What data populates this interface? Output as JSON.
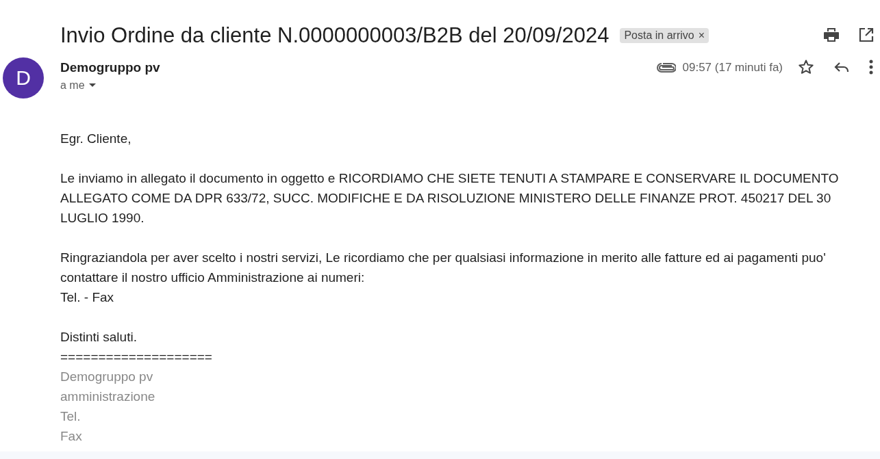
{
  "subject": "Invio Ordine da cliente N.0000000003/B2B del 20/09/2024",
  "label": {
    "text": "Posta in arrivo",
    "remove": "×"
  },
  "sender": {
    "initial": "D",
    "name": "Demogruppo pv",
    "recipient": "a me"
  },
  "time": "09:57 (17 minuti fa)",
  "starred": false,
  "has_attachment": true,
  "body": [
    {
      "kind": "text",
      "text": "Egr. Cliente,"
    },
    {
      "kind": "text",
      "text": "Le inviamo in allegato il documento in oggetto e RICORDIAMO CHE SIETE TENUTI A STAMPARE E CONSERVARE IL DOCUMENTO ALLEGATO COME DA DPR 633/72, SUCC. MODIFICHE E DA RISOLUZIONE MINISTERO DELLE FINANZE PROT. 450217 DEL 30 LUGLIO 1990."
    },
    {
      "kind": "text",
      "text": "Ringraziandola per aver scelto i nostri servizi, Le ricordiamo che per qualsiasi informazione in merito alle fatture ed ai pagamenti puo' contattare il nostro ufficio Amministrazione ai numeri:\nTel. - Fax"
    },
    {
      "kind": "text",
      "text": "Distinti saluti.\n===================="
    },
    {
      "kind": "signature",
      "lines": [
        "Demogruppo pv",
        "amministrazione",
        "Tel.",
        "Fax"
      ]
    }
  ]
}
